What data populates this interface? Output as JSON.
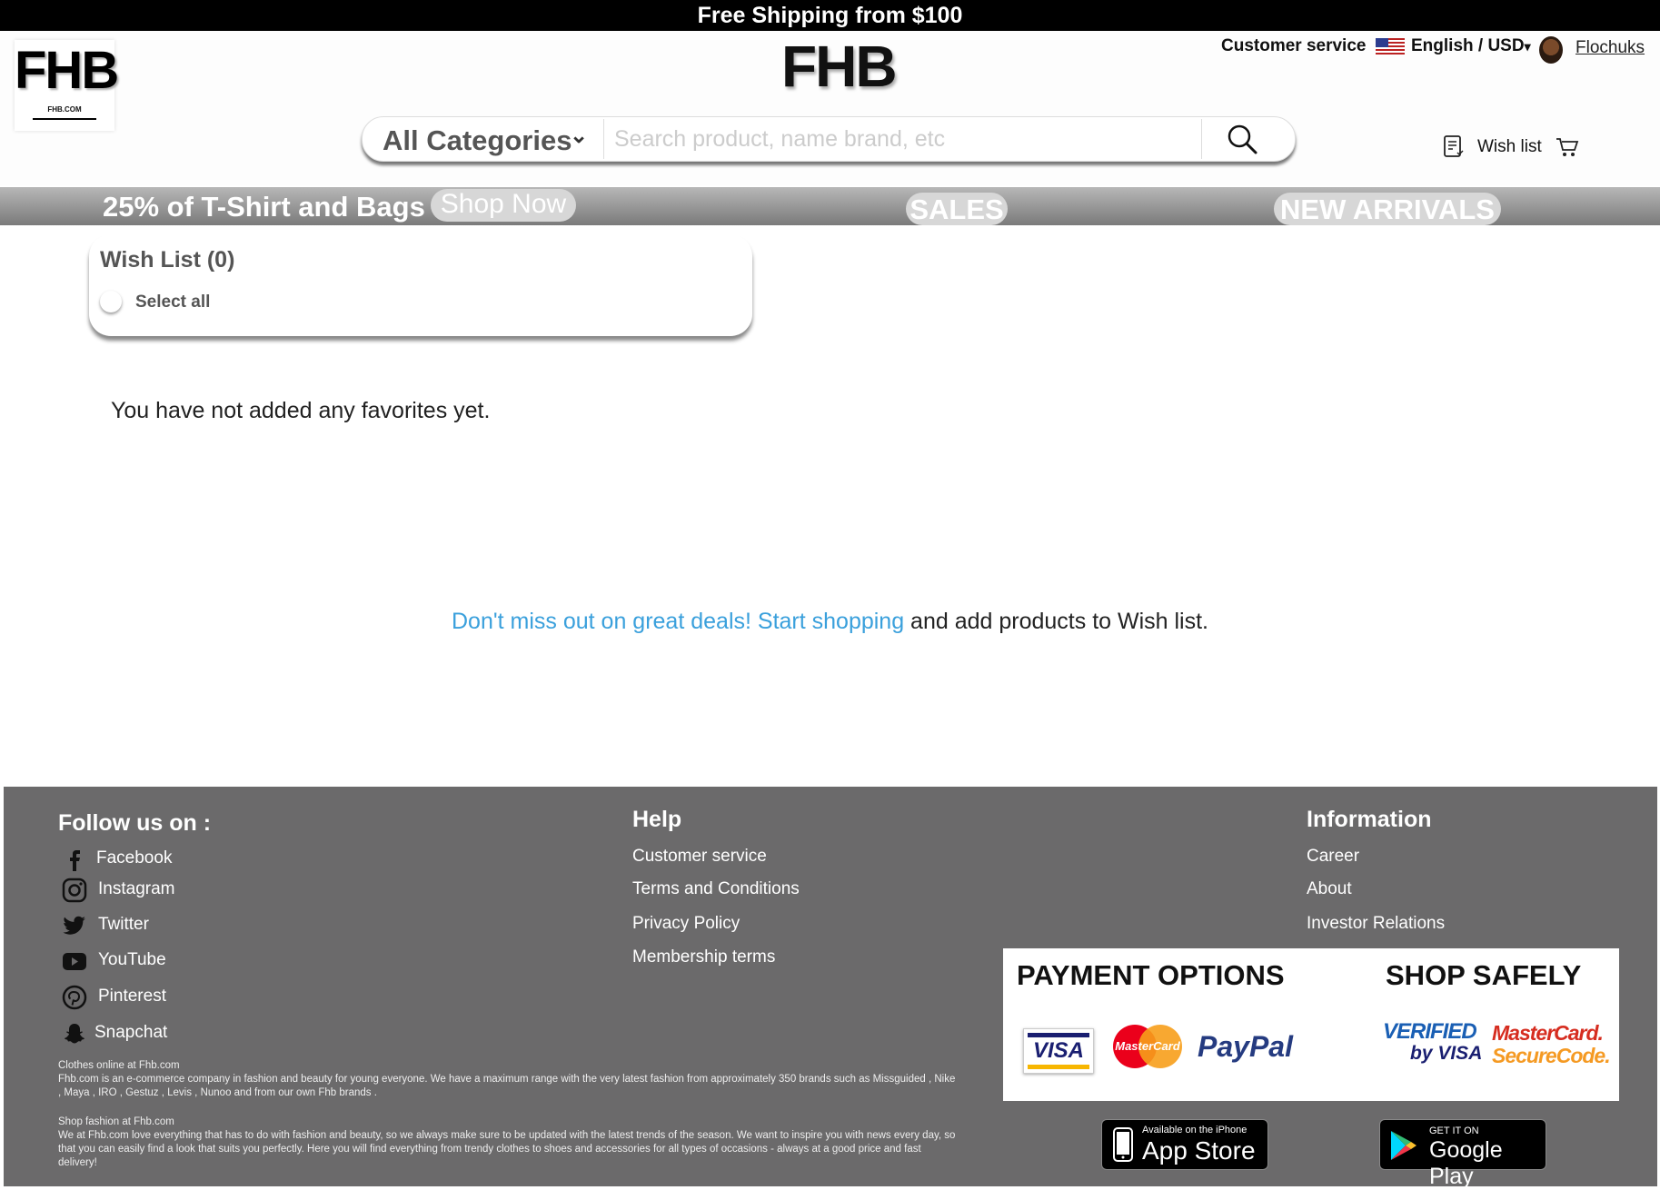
{
  "banner": {
    "text": "Free Shipping from $100"
  },
  "logo": {
    "text": "FHB",
    "subtext": "FHB.COM"
  },
  "center_logo": {
    "text": "FHB"
  },
  "topnav": {
    "customer_service": "Customer service",
    "language": "English / USD",
    "username": "Flochuks"
  },
  "search": {
    "category": "All Categories",
    "placeholder": "Search product, name brand, etc"
  },
  "header_actions": {
    "wish_list": "Wish list"
  },
  "promo": {
    "text": "25% of T-Shirt and Bags",
    "shop_now": "Shop Now",
    "sales": "SALES",
    "new_arrivals": "NEW ARRIVALS"
  },
  "wishlist": {
    "title": "Wish List (0)",
    "select_all": "Select all",
    "empty_message": "You have not added any favorites yet.",
    "cta_link": "Don't miss out on great deals! Start shopping",
    "cta_rest": " and add products to Wish list."
  },
  "footer": {
    "follow_title": "Follow us on :",
    "social": [
      {
        "label": "Facebook",
        "icon": "facebook-icon"
      },
      {
        "label": "Instagram",
        "icon": "instagram-icon"
      },
      {
        "label": "Twitter",
        "icon": "twitter-icon"
      },
      {
        "label": "YouTube",
        "icon": "youtube-icon"
      },
      {
        "label": "Pinterest",
        "icon": "pinterest-icon"
      },
      {
        "label": "Snapchat",
        "icon": "snapchat-icon"
      }
    ],
    "help": {
      "title": "Help",
      "items": [
        "Customer service",
        "Terms and Conditions",
        "Privacy Policy",
        "Membership terms"
      ]
    },
    "information": {
      "title": "Information",
      "items": [
        "Career",
        "About",
        "Investor Relations"
      ]
    },
    "about_title": "Clothes online at Fhb.com",
    "about_text": "Fhb.com is an e-commerce company in fashion and beauty for young everyone. We have a maximum range with the very latest fashion from approximately 350 brands such as Missguided , Nike , Maya , IRO , Gestuz , Levis , Nunoo and from our own Fhb brands .",
    "shop_title": "Shop fashion at Fhb.com",
    "shop_text": "We at Fhb.com love everything that has to do with fashion and beauty, so we always make sure to be updated with the latest trends of the season. We want to inspire you with news every day, so that you can easily find a look that suits you perfectly. Here you will find everything from trendy clothes to shoes and accessories for all types of occasions - always at a good price and fast delivery!",
    "payment_title": "PAYMENT OPTIONS",
    "safety_title": "SHOP SAFELY",
    "payment_logos": {
      "visa": "VISA",
      "mastercard": "MasterCard",
      "paypal": "PayPal"
    },
    "safety_logos": {
      "verified_1": "VERIFIED",
      "verified_2": "by VISA",
      "securecode_1": "MasterCard.",
      "securecode_2": "SecureCode."
    },
    "app_store": {
      "small": "Available on the iPhone",
      "big": "App Store"
    },
    "google_play": {
      "small": "GET IT ON",
      "big": "Google Play"
    }
  },
  "colors": {
    "link": "#3aa0dc",
    "footer_bg": "#6b6a6b",
    "promo_band": "#8a8a8a",
    "top_bar": "#000000"
  }
}
